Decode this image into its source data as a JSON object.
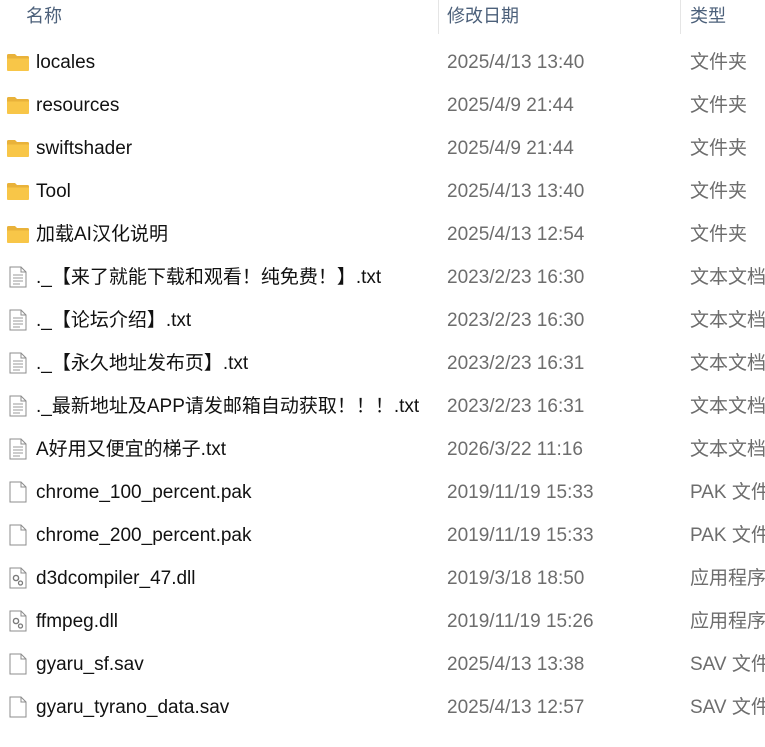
{
  "columns": {
    "name": "名称",
    "date": "修改日期",
    "type": "类型"
  },
  "rows": [
    {
      "name": "locales",
      "date": "2025/4/13 13:40",
      "type": "文件夹",
      "icon": "folder-icon"
    },
    {
      "name": "resources",
      "date": "2025/4/9 21:44",
      "type": "文件夹",
      "icon": "folder-icon"
    },
    {
      "name": "swiftshader",
      "date": "2025/4/9 21:44",
      "type": "文件夹",
      "icon": "folder-icon"
    },
    {
      "name": "Tool",
      "date": "2025/4/13 13:40",
      "type": "文件夹",
      "icon": "folder-icon"
    },
    {
      "name": "加载AI汉化说明",
      "date": "2025/4/13 12:54",
      "type": "文件夹",
      "icon": "folder-icon"
    },
    {
      "name": "._【来了就能下载和观看！纯免费！】.txt",
      "date": "2023/2/23 16:30",
      "type": "文本文档",
      "icon": "text-file-icon"
    },
    {
      "name": "._【论坛介绍】.txt",
      "date": "2023/2/23 16:30",
      "type": "文本文档",
      "icon": "text-file-icon"
    },
    {
      "name": "._【永久地址发布页】.txt",
      "date": "2023/2/23 16:31",
      "type": "文本文档",
      "icon": "text-file-icon"
    },
    {
      "name": "._最新地址及APP请发邮箱自动获取！！！.txt",
      "date": "2023/2/23 16:31",
      "type": "文本文档",
      "icon": "text-file-icon"
    },
    {
      "name": "A好用又便宜的梯子.txt",
      "date": "2026/3/22 11:16",
      "type": "文本文档",
      "icon": "text-file-icon"
    },
    {
      "name": "chrome_100_percent.pak",
      "date": "2019/11/19 15:33",
      "type": "PAK 文件",
      "icon": "blank-file-icon"
    },
    {
      "name": "chrome_200_percent.pak",
      "date": "2019/11/19 15:33",
      "type": "PAK 文件",
      "icon": "blank-file-icon"
    },
    {
      "name": "d3dcompiler_47.dll",
      "date": "2019/3/18 18:50",
      "type": "应用程序扩",
      "icon": "dll-file-icon"
    },
    {
      "name": "ffmpeg.dll",
      "date": "2019/11/19 15:26",
      "type": "应用程序扩",
      "icon": "dll-file-icon"
    },
    {
      "name": "gyaru_sf.sav",
      "date": "2025/4/13 13:38",
      "type": "SAV 文件",
      "icon": "blank-file-icon"
    },
    {
      "name": "gyaru_tyrano_data.sav",
      "date": "2025/4/13 12:57",
      "type": "SAV 文件",
      "icon": "blank-file-icon"
    }
  ],
  "colors": {
    "folder": "#f8c648",
    "header_text": "#4c607a",
    "secondary_text": "#6d6d6d"
  }
}
